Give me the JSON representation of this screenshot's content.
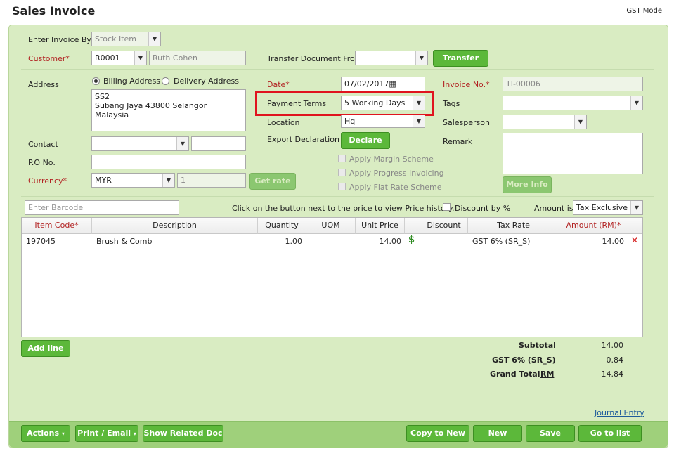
{
  "header": {
    "title": "Sales Invoice",
    "mode": "GST Mode"
  },
  "form": {
    "enter_invoice_by_label": "Enter Invoice By",
    "enter_invoice_by_value": "Stock Item",
    "customer_label": "Customer*",
    "customer_code": "R0001",
    "customer_name": "Ruth Cohen",
    "transfer_doc_label": "Transfer Document From",
    "transfer_doc_value": "",
    "transfer_button": "Transfer",
    "address_label": "Address",
    "billing_address": "Billing Address",
    "delivery_address": "Delivery Address",
    "address_lines": [
      "SS2",
      "Subang Jaya 43800 Selangor",
      "Malaysia"
    ],
    "contact_label": "Contact",
    "po_label": "P.O No.",
    "currency_label": "Currency*",
    "currency_value": "MYR",
    "rate_value": "1",
    "get_rate_button": "Get rate",
    "date_label": "Date*",
    "date_value": "07/02/2017",
    "payment_terms_label": "Payment Terms",
    "payment_terms_value": "5 Working Days",
    "location_label": "Location",
    "location_value": "Hq",
    "export_decl_label": "Export Declaration",
    "declare_button": "Declare",
    "apply_margin": "Apply Margin Scheme",
    "apply_progress": "Apply Progress Invoicing",
    "apply_flat": "Apply Flat Rate Scheme",
    "invoice_no_label": "Invoice No.*",
    "invoice_no_value": "TI-00006",
    "tags_label": "Tags",
    "salesperson_label": "Salesperson",
    "remark_label": "Remark",
    "more_info_button": "More Info"
  },
  "line_bar": {
    "barcode_placeholder": "Enter Barcode",
    "hint": "Click on the button next to the price to view Price history.",
    "discount_by_pct": "Discount by %",
    "amount_is_label": "Amount is:",
    "amount_is_value": "Tax Exclusive"
  },
  "grid": {
    "headers": {
      "item_code": "Item Code*",
      "description": "Description",
      "quantity": "Quantity",
      "uom": "UOM",
      "unit_price": "Unit Price",
      "discount": "Discount",
      "tax_rate": "Tax Rate",
      "amount": "Amount (RM)*"
    },
    "rows": [
      {
        "item_code": "197045",
        "description": "Brush & Comb",
        "quantity": "1.00",
        "uom": "",
        "unit_price": "14.00",
        "discount": "",
        "tax_rate": "GST 6% (SR_S)",
        "amount": "14.00"
      }
    ]
  },
  "add_line_button": "Add line",
  "totals": {
    "subtotal_label": "Subtotal",
    "subtotal": "14.00",
    "gst_label": "GST 6% (SR_S)",
    "gst": "0.84",
    "grand_total_label": "Grand Total",
    "currency_link": "RM",
    "grand_total": "14.84"
  },
  "journal_entry_link": "Journal Entry",
  "actions": {
    "actions": "Actions",
    "print_email": "Print / Email",
    "show_related": "Show Related Doc",
    "copy_to_new": "Copy to New",
    "new": "New",
    "save": "Save",
    "go_to_list": "Go to list"
  },
  "colors": {
    "panel": "#d9ecc2",
    "button": "#5cb83a",
    "highlight": "#e0141e",
    "required": "#b22222"
  }
}
